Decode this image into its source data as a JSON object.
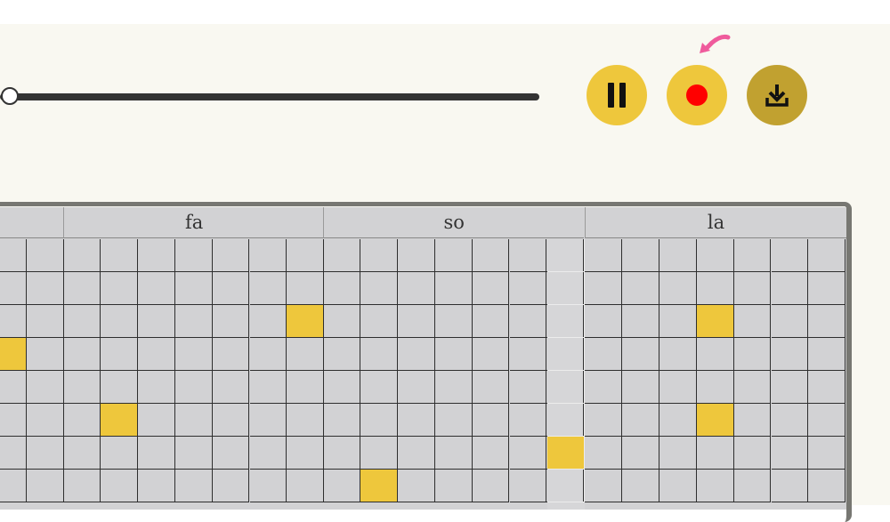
{
  "controls": {
    "progress": 0,
    "pause": {
      "icon": "pause-icon",
      "bg": "#eec73c"
    },
    "record": {
      "icon": "record-icon",
      "bg": "#eec73c",
      "dot": "#ff0000"
    },
    "download": {
      "icon": "download-icon",
      "bg": "#c1a130"
    },
    "hint": {
      "icon": "pointer-arrow-icon",
      "color": "#ef5b9c"
    }
  },
  "grid": {
    "headers": [
      "",
      "fa",
      "so",
      "la"
    ],
    "columns_per_group": [
      2,
      7,
      7,
      7
    ],
    "visible_rows": 8,
    "colors": {
      "cell_off": "#d2d2d4",
      "cell_on": "#eec73c",
      "line": "#2e2e2e"
    },
    "active_cells": [
      {
        "group": 0,
        "col": 0,
        "row": 3
      },
      {
        "group": 1,
        "col": 1,
        "row": 5
      },
      {
        "group": 1,
        "col": 6,
        "row": 2
      },
      {
        "group": 2,
        "col": 1,
        "row": 7
      },
      {
        "group": "spacer",
        "row": 6
      },
      {
        "group": 3,
        "col": 3,
        "row": 2
      },
      {
        "group": 3,
        "col": 3,
        "row": 5
      }
    ]
  }
}
